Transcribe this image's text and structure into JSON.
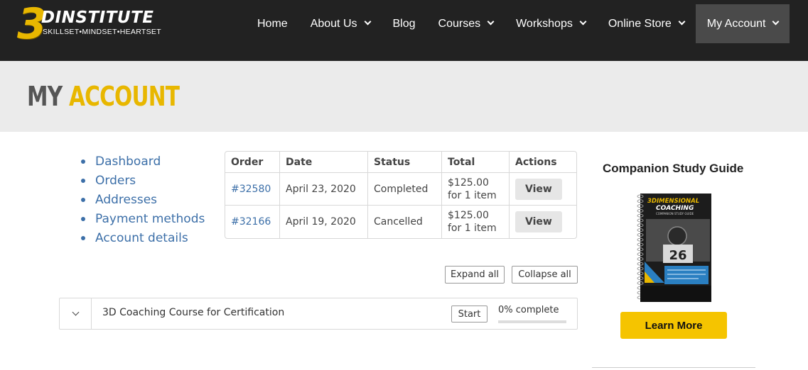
{
  "header": {
    "logo": {
      "mark": "3",
      "name": "DINSTITUTE",
      "tagline": "SKILLSET•MINDSET•HEARTSET"
    },
    "nav": [
      {
        "label": "Home",
        "has_dropdown": false,
        "active": false
      },
      {
        "label": "About Us",
        "has_dropdown": true,
        "active": false
      },
      {
        "label": "Blog",
        "has_dropdown": false,
        "active": false
      },
      {
        "label": "Courses",
        "has_dropdown": true,
        "active": false
      },
      {
        "label": "Workshops",
        "has_dropdown": true,
        "active": false
      },
      {
        "label": "Online Store",
        "has_dropdown": true,
        "active": false
      },
      {
        "label": "My Account",
        "has_dropdown": true,
        "active": true
      }
    ]
  },
  "page": {
    "title_part1": "MY",
    "title_part2": "ACCOUNT"
  },
  "account_nav": [
    "Dashboard",
    "Orders",
    "Addresses",
    "Payment methods",
    "Account details"
  ],
  "orders": {
    "headers": [
      "Order",
      "Date",
      "Status",
      "Total",
      "Actions"
    ],
    "rows": [
      {
        "order": "#32580",
        "date": "April 23, 2020",
        "status": "Completed",
        "total": "$125.00",
        "items": "for 1 item",
        "action": "View"
      },
      {
        "order": "#32166",
        "date": "April 19, 2020",
        "status": "Cancelled",
        "total": "$125.00",
        "items": "for 1 item",
        "action": "View"
      }
    ]
  },
  "course_controls": {
    "expand_all": "Expand all",
    "collapse_all": "Collapse all"
  },
  "course": {
    "name": "3D Coaching Course for Certification",
    "start_label": "Start",
    "progress_text": "0% complete",
    "progress": 0
  },
  "sidebar": {
    "title": "Companion Study Guide",
    "book_title_1": "3DIMENSIONAL",
    "book_title_2": "COACHING",
    "book_subtitle": "COMPANION STUDY GUIDE",
    "book_jersey": "26",
    "button": "Learn More"
  },
  "colors": {
    "header_bg": "#222222",
    "accent_gold": "#e8b700",
    "button_yellow": "#f5c400",
    "link_blue": "#3c6fa8",
    "title_band_bg": "#ebebeb"
  }
}
